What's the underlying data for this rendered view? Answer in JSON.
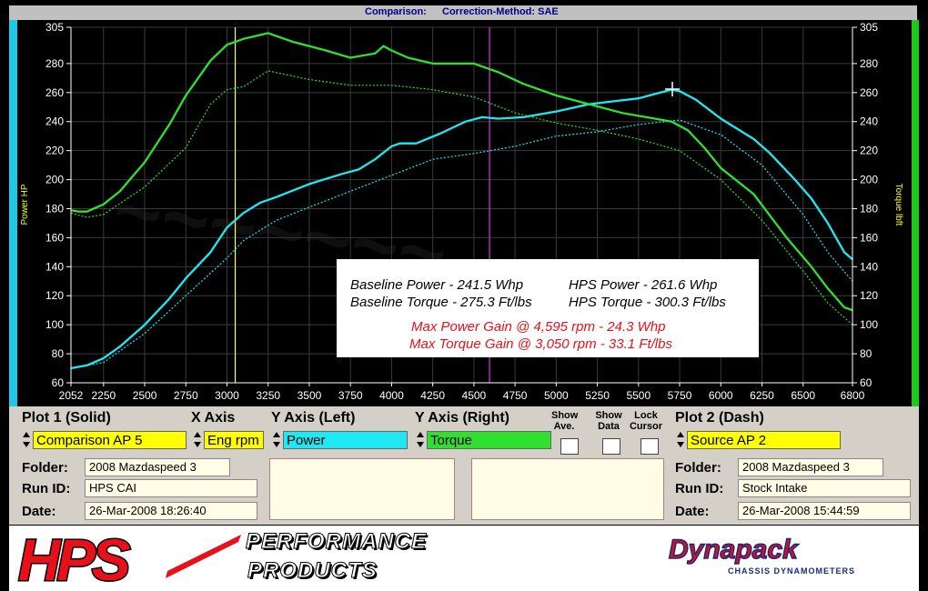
{
  "title_bar": {
    "comparison_label": "Comparison:",
    "correction_label": "Correction-Method: SAE"
  },
  "colors": {
    "power": "#1ee8f2",
    "torque": "#2fe02f",
    "panel": "#d4d0c8",
    "field": "#fffde6",
    "yellow_select": "#ffff00"
  },
  "chart_data": {
    "type": "line",
    "xlabel": "",
    "ylabel_left": "Power HP",
    "ylabel_right": "Torque lbft",
    "xlim": [
      2052,
      6800
    ],
    "ylim": [
      60,
      305
    ],
    "x_ticks": [
      "2052",
      "2250",
      "2500",
      "2750",
      "3000",
      "3250",
      "3500",
      "3750",
      "4000",
      "4250",
      "4500",
      "4750",
      "5000",
      "5250",
      "5500",
      "5750",
      "6000",
      "6250",
      "6500",
      "6800"
    ],
    "y_ticks": [
      "305",
      "280",
      "260",
      "240",
      "220",
      "200",
      "180",
      "160",
      "140",
      "120",
      "100",
      "80",
      "60"
    ],
    "y_ticks_right": [
      "305",
      "280",
      "260",
      "240",
      "220",
      "200",
      "180",
      "160",
      "140",
      "120",
      "100",
      "80",
      "60"
    ],
    "markers": [
      3050,
      4595
    ],
    "series": [
      {
        "name": "Comparison AP 5 Power",
        "style": "solid",
        "color": "#1ee8f2",
        "x": [
          2052,
          2150,
          2250,
          2350,
          2500,
          2650,
          2750,
          2900,
          3000,
          3100,
          3200,
          3300,
          3500,
          3700,
          3800,
          3900,
          4000,
          4050,
          4150,
          4300,
          4450,
          4550,
          4650,
          4800,
          5000,
          5200,
          5350,
          5500,
          5600,
          5700,
          5750,
          5850,
          6000,
          6200,
          6300,
          6450,
          6550,
          6650,
          6700,
          6750,
          6800
        ],
        "values": [
          70,
          72,
          77,
          85,
          100,
          118,
          132,
          150,
          167,
          177,
          184,
          188,
          197,
          204,
          207,
          214,
          223,
          225,
          225,
          232,
          240,
          243,
          242,
          243,
          247,
          252,
          254,
          256,
          259,
          262,
          261,
          255,
          242,
          228,
          218,
          200,
          187,
          170,
          160,
          150,
          145
        ]
      },
      {
        "name": "Comparison AP 5 Torque",
        "style": "solid",
        "color": "#2fe02f",
        "x": [
          2052,
          2100,
          2150,
          2250,
          2350,
          2500,
          2650,
          2750,
          2900,
          3000,
          3100,
          3250,
          3400,
          3600,
          3750,
          3900,
          3950,
          4000,
          4100,
          4250,
          4400,
          4500,
          4650,
          4800,
          5000,
          5200,
          5400,
          5600,
          5700,
          5800,
          5900,
          6000,
          6200,
          6400,
          6550,
          6650,
          6750,
          6800
        ],
        "values": [
          179,
          178,
          178,
          183,
          192,
          212,
          238,
          258,
          282,
          293,
          297,
          301,
          295,
          289,
          284,
          287,
          292,
          289,
          284,
          280,
          280,
          280,
          274,
          266,
          258,
          252,
          246,
          242,
          240,
          234,
          222,
          208,
          190,
          160,
          140,
          125,
          112,
          110
        ]
      },
      {
        "name": "Source AP 2 Power",
        "style": "dash",
        "color": "#1ee8f2",
        "x": [
          2052,
          2250,
          2500,
          2750,
          3000,
          3100,
          3300,
          3500,
          3750,
          4000,
          4250,
          4500,
          4750,
          5000,
          5250,
          5500,
          5750,
          6000,
          6250,
          6500,
          6650,
          6800
        ],
        "values": [
          70,
          74,
          94,
          120,
          146,
          158,
          172,
          181,
          192,
          203,
          214,
          218,
          223,
          230,
          233,
          238,
          241,
          231,
          210,
          176,
          150,
          130
        ]
      },
      {
        "name": "Source AP 2 Torque",
        "style": "dash",
        "color": "#2fe02f",
        "x": [
          2052,
          2150,
          2250,
          2500,
          2750,
          2900,
          3000,
          3100,
          3250,
          3500,
          3750,
          4000,
          4250,
          4500,
          4750,
          5000,
          5250,
          5500,
          5750,
          6000,
          6250,
          6500,
          6650,
          6800
        ],
        "values": [
          177,
          174,
          176,
          195,
          222,
          252,
          262,
          264,
          275,
          269,
          265,
          265,
          262,
          257,
          246,
          239,
          234,
          228,
          220,
          200,
          172,
          137,
          115,
          100
        ]
      }
    ]
  },
  "annotation": {
    "baseline_power": "Baseline Power - 241.5 Whp",
    "baseline_torque": "Baseline Torque - 275.3 Ft/lbs",
    "hps_power": "HPS Power - 261.6 Whp",
    "hps_torque": "HPS Torque - 300.3 Ft/lbs",
    "max_power_gain": "Max Power Gain @ 4,595 rpm - 24.3 Whp",
    "max_torque_gain": "Max Torque Gain @ 3,050 rpm - 33.1 Ft/lbs"
  },
  "panel": {
    "plot1_label": "Plot 1 (Solid)",
    "x_axis_label": "X Axis",
    "y_left_label": "Y Axis (Left)",
    "y_right_label": "Y Axis (Right)",
    "show_ave_label": "Show Ave.",
    "show_data_label": "Show Data",
    "lock_cursor_label": "Lock Cursor",
    "plot2_label": "Plot 2 (Dash)",
    "plot1_value": "Comparison AP 5",
    "x_axis_value": "Eng rpm",
    "y_left_value": "Power",
    "y_right_value": "Torque",
    "plot2_value": "Source AP 2",
    "folder_label": "Folder:",
    "runid_label": "Run ID:",
    "date_label": "Date:",
    "plot1_folder": "2008 Mazdaspeed 3",
    "plot1_runid": "HPS CAI",
    "plot1_date": "26-Mar-2008  18:26:40",
    "plot2_folder": "2008 Mazdaspeed 3",
    "plot2_runid": "Stock Intake",
    "plot2_date": "26-Mar-2008  15:44:59"
  },
  "footer": {
    "hps_logo": "HPS",
    "performance": "PERFORMANCE",
    "products": "PRODUCTS",
    "dynapack": "Dynapack",
    "dynapack_sub": "CHASSIS DYNAMOMETERS"
  }
}
